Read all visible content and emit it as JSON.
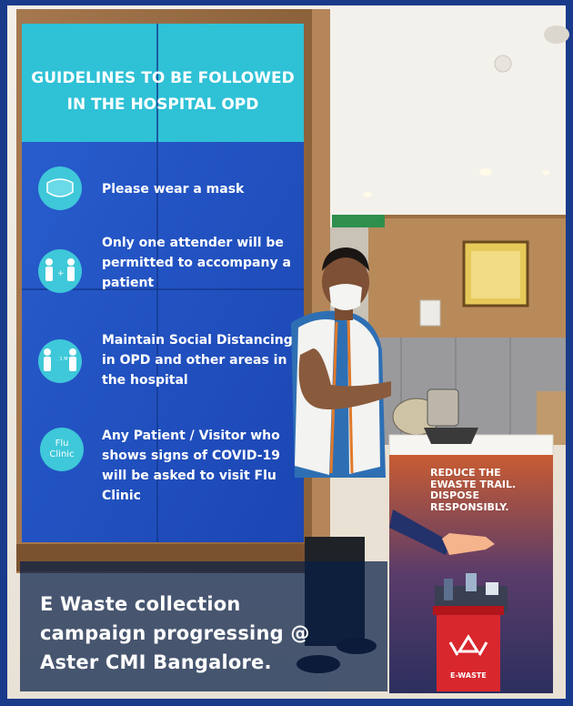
{
  "screen": {
    "title_line1": "GUIDELINES TO BE FOLLOWED",
    "title_line2": "IN THE HOSPITAL OPD",
    "items": [
      {
        "icon": "mask-icon",
        "text": "Please wear a mask"
      },
      {
        "icon": "attender-icon",
        "text": "Only one attender will be permitted to accompany a patient"
      },
      {
        "icon": "distancing-icon",
        "text": "Maintain Social Distancing in OPD and other areas in the hospital",
        "icon_label": "1 M"
      },
      {
        "icon": "flu-clinic-icon",
        "text": "Any Patient / Visitor who shows signs of COVID-19 will be asked to visit Flu Clinic",
        "icon_label_1": "Flu",
        "icon_label_2": "Clinic"
      }
    ]
  },
  "bin": {
    "line1": "REDUCE THE",
    "line2": "EWASTE TRAIL.",
    "line3": "DISPOSE",
    "line4": "RESPONSIBLY.",
    "bin_label": "E-WASTE"
  },
  "caption": {
    "line1": "E Waste collection",
    "line2": "campaign progressing @",
    "line3": "Aster CMI Bangalore."
  },
  "colors": {
    "screen_blue": "#2456c8",
    "screen_teal": "#2ec6d8",
    "bin_orange": "#d76a3a",
    "caption_bg": "#0a1e46"
  }
}
